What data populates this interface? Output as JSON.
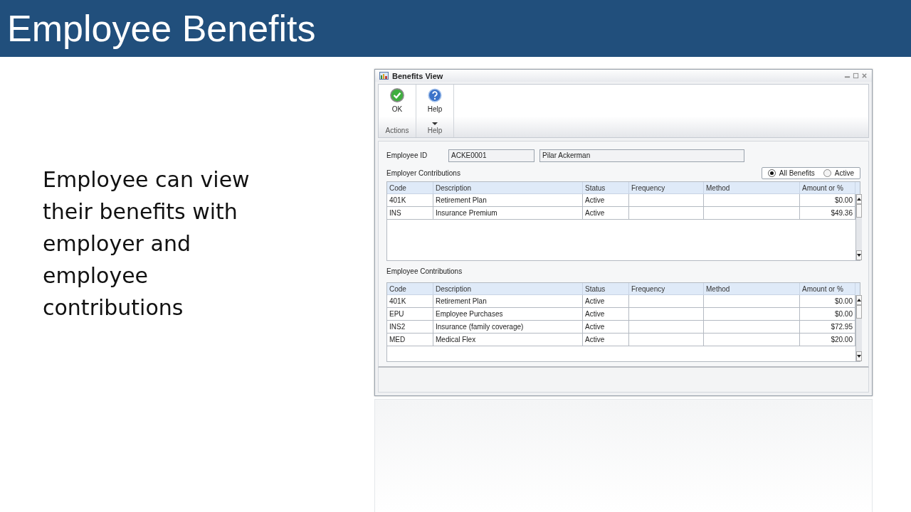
{
  "slide": {
    "title": "Employee Benefits",
    "body": "Employee can view their benefits with employer and employee contributions"
  },
  "window": {
    "title": "Benefits View"
  },
  "ribbon": {
    "groups": [
      {
        "label": "Actions",
        "buttons": [
          {
            "label": "OK",
            "kind": "ok",
            "dropdown": false
          }
        ]
      },
      {
        "label": "Help",
        "buttons": [
          {
            "label": "Help",
            "kind": "help",
            "dropdown": true
          }
        ]
      }
    ]
  },
  "employee": {
    "label": "Employee ID",
    "id": "ACKE0001",
    "name": "Pilar Ackerman"
  },
  "filter": [
    {
      "label": "All Benefits",
      "selected": true
    },
    {
      "label": "Active",
      "selected": false
    }
  ],
  "grids": [
    {
      "title": "Employer Contributions",
      "columns": [
        "Code",
        "Description",
        "Status",
        "Frequency",
        "Method",
        "Amount or %"
      ],
      "rows": [
        {
          "cells": [
            "401K",
            "Retirement Plan",
            "Active",
            "",
            "",
            "$0.00"
          ]
        },
        {
          "cells": [
            "INS",
            "Insurance Premium",
            "Active",
            "",
            "",
            "$49.36"
          ]
        }
      ]
    },
    {
      "title": "Employee Contributions",
      "columns": [
        "Code",
        "Description",
        "Status",
        "Frequency",
        "Method",
        "Amount or %"
      ],
      "rows": [
        {
          "cells": [
            "401K",
            "Retirement Plan",
            "Active",
            "",
            "",
            "$0.00"
          ]
        },
        {
          "cells": [
            "EPU",
            "Employee Purchases",
            "Active",
            "",
            "",
            "$0.00"
          ]
        },
        {
          "cells": [
            "INS2",
            "Insurance (family coverage)",
            "Active",
            "",
            "",
            "$72.95"
          ]
        },
        {
          "cells": [
            "MED",
            "Medical Flex",
            "Active",
            "",
            "",
            "$20.00"
          ]
        }
      ]
    }
  ]
}
